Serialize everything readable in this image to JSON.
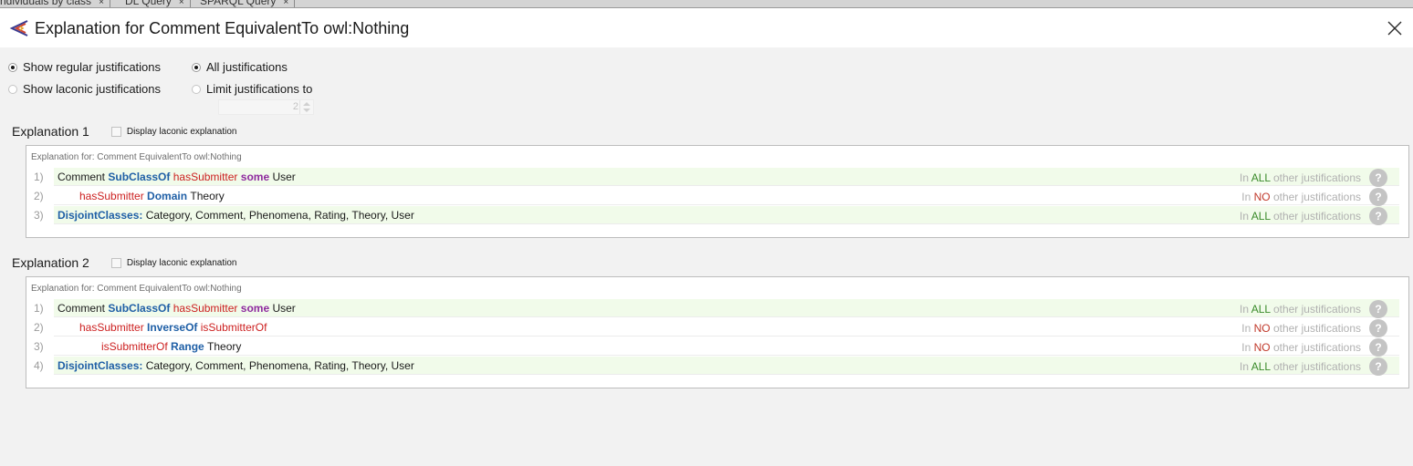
{
  "tabs": [
    {
      "label": "ndividuals by class",
      "close": "×"
    },
    {
      "label": "DL Query",
      "close": "×"
    },
    {
      "label": "SPARQL Query",
      "close": "×"
    }
  ],
  "dialog": {
    "title": "Explanation for Comment EquivalentTo owl:Nothing"
  },
  "options": {
    "show_regular": "Show regular justifications",
    "show_laconic": "Show laconic justifications",
    "all_justifications": "All justifications",
    "limit_justifications": "Limit justifications to",
    "limit_value": "2",
    "selected_mode": "regular",
    "selected_limit": "all"
  },
  "explanations": [
    {
      "title": "Explanation 1",
      "checkbox_label": "Display laconic explanation",
      "caption": "Explanation for: Comment EquivalentTo owl:Nothing",
      "rows": [
        {
          "num": "1)",
          "indent": 0,
          "tokens": [
            {
              "t": "Comment ",
              "c": "plain"
            },
            {
              "t": "SubClassOf ",
              "c": "blue"
            },
            {
              "t": "hasSubmitter ",
              "c": "red"
            },
            {
              "t": "some ",
              "c": "purple"
            },
            {
              "t": "User",
              "c": "plain"
            }
          ],
          "just_prefix": "In ",
          "just_kw": "ALL",
          "just_kind": "all",
          "just_suffix": " other justifications",
          "help": "?",
          "bg": "green"
        },
        {
          "num": "2)",
          "indent": 1,
          "tokens": [
            {
              "t": "hasSubmitter ",
              "c": "red"
            },
            {
              "t": "Domain ",
              "c": "blue"
            },
            {
              "t": "Theory",
              "c": "plain"
            }
          ],
          "just_prefix": "In ",
          "just_kw": "NO",
          "just_kind": "no",
          "just_suffix": " other justifications",
          "help": "?",
          "bg": "white"
        },
        {
          "num": "3)",
          "indent": 0,
          "tokens": [
            {
              "t": "DisjointClasses: ",
              "c": "blue"
            },
            {
              "t": "Category, Comment, Phenomena, Rating, Theory, User",
              "c": "plain"
            }
          ],
          "just_prefix": "In ",
          "just_kw": "ALL",
          "just_kind": "all",
          "just_suffix": " other justifications",
          "help": "?",
          "bg": "green"
        }
      ]
    },
    {
      "title": "Explanation 2",
      "checkbox_label": "Display laconic explanation",
      "caption": "Explanation for: Comment EquivalentTo owl:Nothing",
      "rows": [
        {
          "num": "1)",
          "indent": 0,
          "tokens": [
            {
              "t": "Comment ",
              "c": "plain"
            },
            {
              "t": "SubClassOf ",
              "c": "blue"
            },
            {
              "t": "hasSubmitter ",
              "c": "red"
            },
            {
              "t": "some ",
              "c": "purple"
            },
            {
              "t": "User",
              "c": "plain"
            }
          ],
          "just_prefix": "In ",
          "just_kw": "ALL",
          "just_kind": "all",
          "just_suffix": " other justifications",
          "help": "?",
          "bg": "green"
        },
        {
          "num": "2)",
          "indent": 1,
          "tokens": [
            {
              "t": "hasSubmitter ",
              "c": "red"
            },
            {
              "t": "InverseOf ",
              "c": "blue"
            },
            {
              "t": "isSubmitterOf",
              "c": "red"
            }
          ],
          "just_prefix": "In ",
          "just_kw": "NO",
          "just_kind": "no",
          "just_suffix": " other justifications",
          "help": "?",
          "bg": "white"
        },
        {
          "num": "3)",
          "indent": 2,
          "tokens": [
            {
              "t": "isSubmitterOf ",
              "c": "red"
            },
            {
              "t": "Range ",
              "c": "blue"
            },
            {
              "t": "Theory",
              "c": "plain"
            }
          ],
          "just_prefix": "In ",
          "just_kw": "NO",
          "just_kind": "no",
          "just_suffix": " other justifications",
          "help": "?",
          "bg": "white"
        },
        {
          "num": "4)",
          "indent": 0,
          "tokens": [
            {
              "t": "DisjointClasses: ",
              "c": "blue"
            },
            {
              "t": "Category, Comment, Phenomena, Rating, Theory, User",
              "c": "plain"
            }
          ],
          "just_prefix": "In ",
          "just_kw": "ALL",
          "just_kind": "all",
          "just_suffix": " other justifications",
          "help": "?",
          "bg": "green"
        }
      ]
    }
  ],
  "colors": {
    "keyword_blue": "#1f5fa6",
    "property_red": "#cc1f1f",
    "quantifier_purple": "#8e2a9e",
    "all_green": "#3a8a2a",
    "no_red": "#c0392b",
    "row_highlight": "#f1fbea"
  },
  "icons": {
    "app": "protege-logo-icon",
    "close": "close-icon",
    "help": "help-icon"
  }
}
